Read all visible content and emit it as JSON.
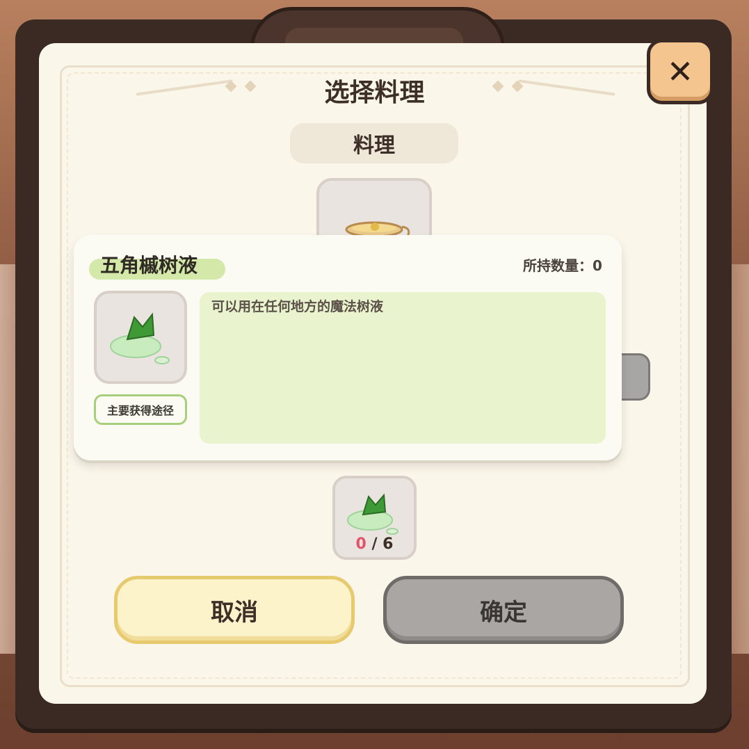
{
  "dialog": {
    "title": "选择料理",
    "tab_label": "料理",
    "close_icon": "close-icon"
  },
  "item_popup": {
    "name": "五角槭树液",
    "owned": "所持数量：0",
    "description": "可以用在任何地方的魔法树液",
    "source_label": "主要获得途径",
    "icon": "maple-sap-icon"
  },
  "ingredient_slot": {
    "count_have": "0",
    "count_sep": " / ",
    "count_need": "6",
    "icon": "maple-sap-icon"
  },
  "top_slot": {
    "icon": "tea-cup-icon"
  },
  "buttons": {
    "cancel": "取消",
    "confirm": "确定"
  },
  "colors": {
    "panel": "#fbf6ea",
    "frame": "#3b2a24",
    "cancel_bg": "#fdf3cb",
    "confirm_bg": "#a9a6a3",
    "highlight_green": "#d4e8a9",
    "count_red": "#e2546a"
  }
}
